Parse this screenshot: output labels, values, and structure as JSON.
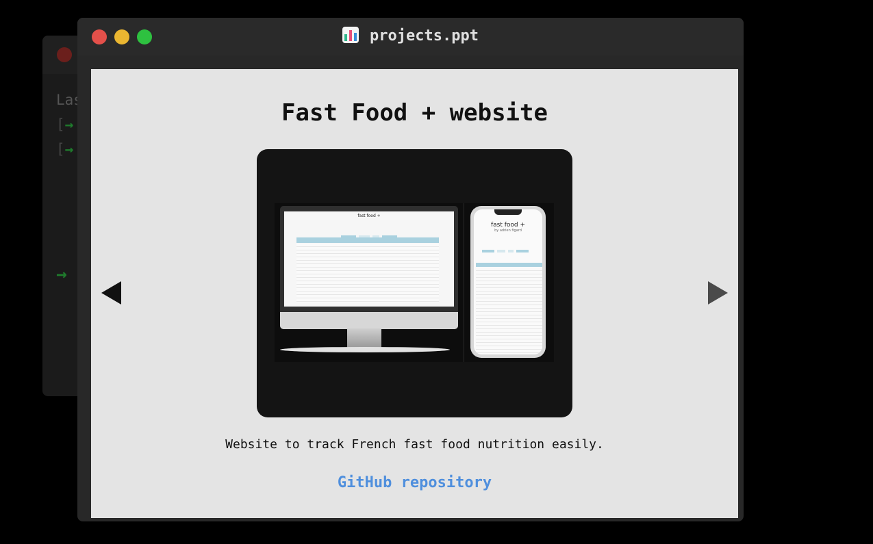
{
  "background_terminal": {
    "line1": "Las",
    "bracket": "[",
    "arrow": "→"
  },
  "window": {
    "title": "projects.ppt",
    "app_icon": "chart-icon"
  },
  "slide": {
    "title": "Fast Food + website",
    "description": "Website to track French fast food nutrition easily.",
    "link_label": "GitHub repository",
    "image": {
      "desktop_title": "fast food +",
      "phone_title": "fast food +",
      "phone_subtitle": "by adrien figard"
    },
    "prev_icon": "triangle-left-icon",
    "next_icon": "triangle-right-icon"
  },
  "colors": {
    "link": "#4f8fdd",
    "close": "#e4504a",
    "minimize": "#eab631",
    "maximize": "#2ec140"
  }
}
